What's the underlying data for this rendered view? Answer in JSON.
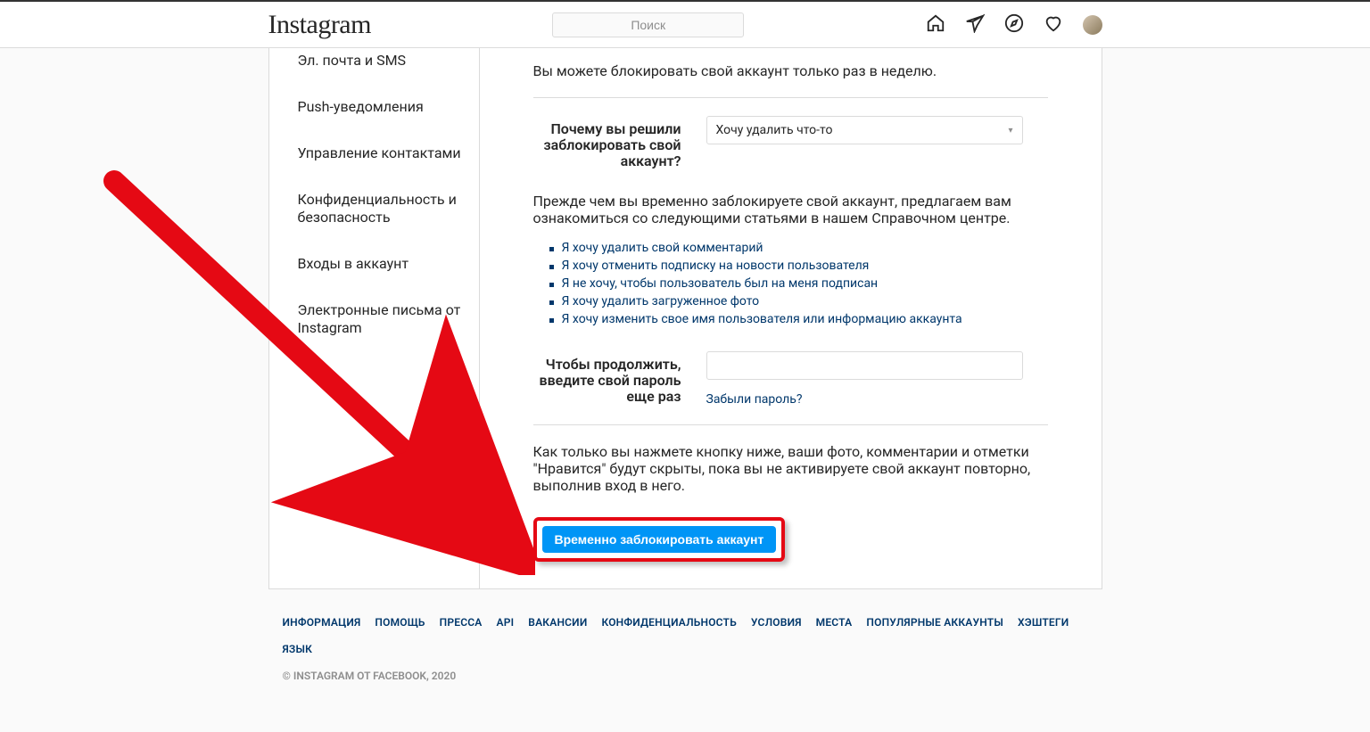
{
  "header": {
    "logo": "Instagram",
    "search_placeholder": "Поиск"
  },
  "sidebar": {
    "items": [
      "Эл. почта и SMS",
      "Push-уведомления",
      "Управление контактами",
      "Конфиденциальность и безопасность",
      "Входы в аккаунт",
      "Электронные письма от Instagram"
    ]
  },
  "main": {
    "limit_text": "Вы можете блокировать свой аккаунт только раз в неделю.",
    "reason_label": "Почему вы решили заблокировать свой аккаунт?",
    "reason_selected": "Хочу удалить что-то",
    "help_intro": "Прежде чем вы временно заблокируете свой аккаунт, предлагаем вам ознакомиться со следующими статьями в нашем Справочном центре.",
    "help_links": [
      "Я хочу удалить свой комментарий",
      "Я хочу отменить подписку на новости пользователя",
      "Я не хочу, чтобы пользователь был на меня подписан",
      "Я хочу удалить загруженное фото",
      "Я хочу изменить свое имя пользователя или информацию аккаунта"
    ],
    "password_label": "Чтобы продолжить, введите свой пароль еще раз",
    "forgot_link": "Забыли пароль?",
    "confirm_text": "Как только вы нажмете кнопку ниже, ваши фото, комментарии и отметки \"Нравится\" будут скрыты, пока вы не активируете свой аккаунт повторно, выполнив вход в него.",
    "submit_label": "Временно заблокировать аккаунт"
  },
  "footer": {
    "links": [
      "ИНФОРМАЦИЯ",
      "ПОМОЩЬ",
      "ПРЕССА",
      "API",
      "ВАКАНСИИ",
      "КОНФИДЕНЦИАЛЬНОСТЬ",
      "УСЛОВИЯ",
      "МЕСТА",
      "ПОПУЛЯРНЫЕ АККАУНТЫ",
      "ХЭШТЕГИ",
      "ЯЗЫК"
    ],
    "copyright": "© INSTAGRAM ОТ FACEBOOK, 2020"
  }
}
